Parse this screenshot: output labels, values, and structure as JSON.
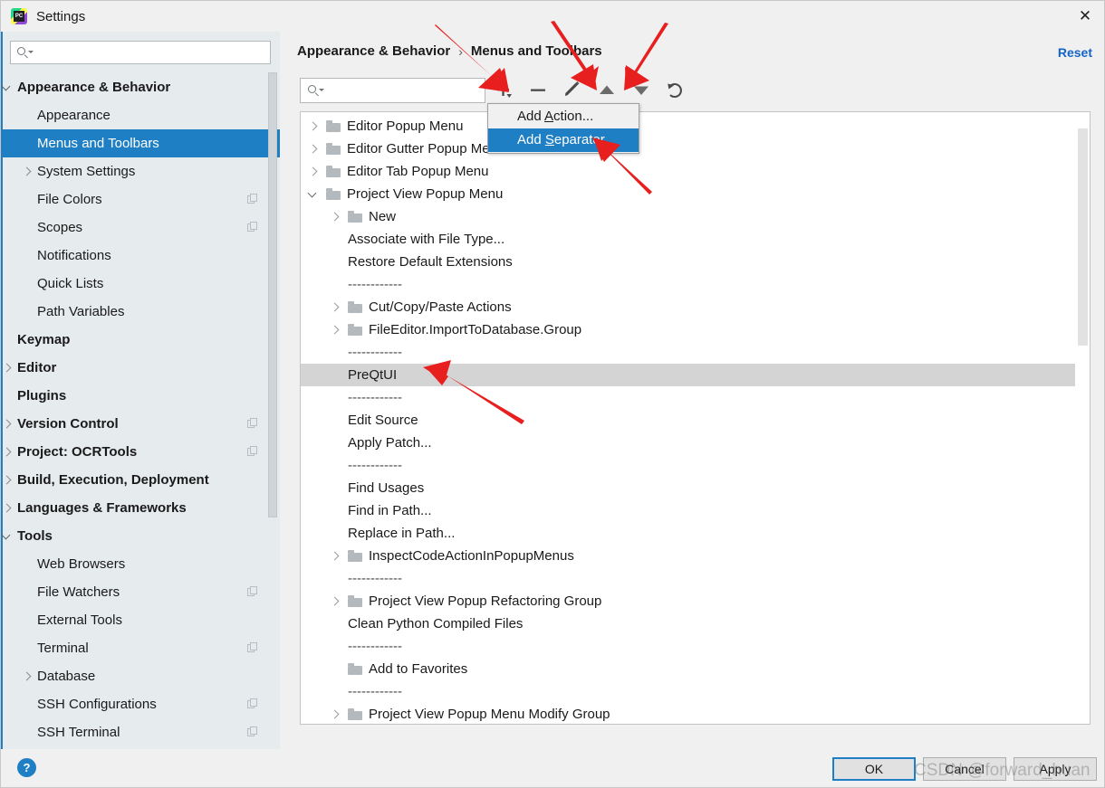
{
  "window": {
    "title": "Settings",
    "app_icon": "pycharm-icon",
    "close_icon": "close-icon"
  },
  "sidebar": {
    "search": {
      "placeholder": "",
      "value": "",
      "icon": "search-icon"
    },
    "items": [
      {
        "label": "Appearance & Behavior",
        "indent": 0,
        "arrow": "down",
        "bold": true,
        "selected": false,
        "copy": false
      },
      {
        "label": "Appearance",
        "indent": 1,
        "arrow": "none",
        "bold": false,
        "selected": false,
        "copy": false
      },
      {
        "label": "Menus and Toolbars",
        "indent": 1,
        "arrow": "none",
        "bold": false,
        "selected": true,
        "copy": false
      },
      {
        "label": "System Settings",
        "indent": 1,
        "arrow": "right",
        "bold": false,
        "selected": false,
        "copy": false
      },
      {
        "label": "File Colors",
        "indent": 1,
        "arrow": "none",
        "bold": false,
        "selected": false,
        "copy": true
      },
      {
        "label": "Scopes",
        "indent": 1,
        "arrow": "none",
        "bold": false,
        "selected": false,
        "copy": true
      },
      {
        "label": "Notifications",
        "indent": 1,
        "arrow": "none",
        "bold": false,
        "selected": false,
        "copy": false
      },
      {
        "label": "Quick Lists",
        "indent": 1,
        "arrow": "none",
        "bold": false,
        "selected": false,
        "copy": false
      },
      {
        "label": "Path Variables",
        "indent": 1,
        "arrow": "none",
        "bold": false,
        "selected": false,
        "copy": false
      },
      {
        "label": "Keymap",
        "indent": 0,
        "arrow": "none",
        "bold": true,
        "selected": false,
        "copy": false
      },
      {
        "label": "Editor",
        "indent": 0,
        "arrow": "right",
        "bold": true,
        "selected": false,
        "copy": false
      },
      {
        "label": "Plugins",
        "indent": 0,
        "arrow": "none",
        "bold": true,
        "selected": false,
        "copy": false
      },
      {
        "label": "Version Control",
        "indent": 0,
        "arrow": "right",
        "bold": true,
        "selected": false,
        "copy": true
      },
      {
        "label": "Project: OCRTools",
        "indent": 0,
        "arrow": "right",
        "bold": true,
        "selected": false,
        "copy": true
      },
      {
        "label": "Build, Execution, Deployment",
        "indent": 0,
        "arrow": "right",
        "bold": true,
        "selected": false,
        "copy": false
      },
      {
        "label": "Languages & Frameworks",
        "indent": 0,
        "arrow": "right",
        "bold": true,
        "selected": false,
        "copy": false
      },
      {
        "label": "Tools",
        "indent": 0,
        "arrow": "down",
        "bold": true,
        "selected": false,
        "copy": false
      },
      {
        "label": "Web Browsers",
        "indent": 1,
        "arrow": "none",
        "bold": false,
        "selected": false,
        "copy": false
      },
      {
        "label": "File Watchers",
        "indent": 1,
        "arrow": "none",
        "bold": false,
        "selected": false,
        "copy": true
      },
      {
        "label": "External Tools",
        "indent": 1,
        "arrow": "none",
        "bold": false,
        "selected": false,
        "copy": false
      },
      {
        "label": "Terminal",
        "indent": 1,
        "arrow": "none",
        "bold": false,
        "selected": false,
        "copy": true
      },
      {
        "label": "Database",
        "indent": 1,
        "arrow": "right",
        "bold": false,
        "selected": false,
        "copy": false
      },
      {
        "label": "SSH Configurations",
        "indent": 1,
        "arrow": "none",
        "bold": false,
        "selected": false,
        "copy": true
      },
      {
        "label": "SSH Terminal",
        "indent": 1,
        "arrow": "none",
        "bold": false,
        "selected": false,
        "copy": true
      }
    ]
  },
  "content": {
    "breadcrumb": {
      "parent": "Appearance & Behavior",
      "separator": "›",
      "current": "Menus and Toolbars"
    },
    "reset_label": "Reset",
    "search": {
      "placeholder": "",
      "value": "",
      "icon": "search-icon"
    },
    "toolbar": [
      {
        "name": "add-button",
        "icon": "plus-icon",
        "label": "Add"
      },
      {
        "name": "remove-button",
        "icon": "minus-icon",
        "label": "Remove"
      },
      {
        "name": "edit-button",
        "icon": "pencil-icon",
        "label": "Edit"
      },
      {
        "name": "move-up-button",
        "icon": "arrow-up-icon",
        "label": "Move Up"
      },
      {
        "name": "move-down-button",
        "icon": "arrow-down-icon",
        "label": "Move Down"
      },
      {
        "name": "restore-button",
        "icon": "revert-icon",
        "label": "Restore"
      }
    ],
    "tree": [
      {
        "label": "Editor Popup Menu",
        "indent": 0,
        "arrow": "right",
        "folder": true,
        "kind": "item",
        "selected": false
      },
      {
        "label": "Editor Gutter Popup Menu",
        "indent": 0,
        "arrow": "right",
        "folder": true,
        "kind": "item",
        "selected": false
      },
      {
        "label": "Editor Tab Popup Menu",
        "indent": 0,
        "arrow": "right",
        "folder": true,
        "kind": "item",
        "selected": false
      },
      {
        "label": "Project View Popup Menu",
        "indent": 0,
        "arrow": "down",
        "folder": true,
        "kind": "item",
        "selected": false
      },
      {
        "label": "New",
        "indent": 1,
        "arrow": "right",
        "folder": true,
        "kind": "item",
        "selected": false
      },
      {
        "label": "Associate with File Type...",
        "indent": 1,
        "arrow": "none",
        "folder": false,
        "kind": "item",
        "selected": false
      },
      {
        "label": "Restore Default Extensions",
        "indent": 1,
        "arrow": "none",
        "folder": false,
        "kind": "item",
        "selected": false
      },
      {
        "label": "------------",
        "indent": 1,
        "arrow": "none",
        "folder": false,
        "kind": "separator",
        "selected": false
      },
      {
        "label": "Cut/Copy/Paste Actions",
        "indent": 1,
        "arrow": "right",
        "folder": true,
        "kind": "item",
        "selected": false
      },
      {
        "label": "FileEditor.ImportToDatabase.Group",
        "indent": 1,
        "arrow": "right",
        "folder": true,
        "kind": "item",
        "selected": false
      },
      {
        "label": "------------",
        "indent": 1,
        "arrow": "none",
        "folder": false,
        "kind": "separator",
        "selected": false
      },
      {
        "label": "PreQtUI",
        "indent": 1,
        "arrow": "none",
        "folder": false,
        "kind": "item",
        "selected": true
      },
      {
        "label": "------------",
        "indent": 1,
        "arrow": "none",
        "folder": false,
        "kind": "separator",
        "selected": false
      },
      {
        "label": "Edit Source",
        "indent": 1,
        "arrow": "none",
        "folder": false,
        "kind": "item",
        "selected": false
      },
      {
        "label": "Apply Patch...",
        "indent": 1,
        "arrow": "none",
        "folder": false,
        "kind": "item",
        "selected": false
      },
      {
        "label": "------------",
        "indent": 1,
        "arrow": "none",
        "folder": false,
        "kind": "separator",
        "selected": false
      },
      {
        "label": "Find Usages",
        "indent": 1,
        "arrow": "none",
        "folder": false,
        "kind": "item",
        "selected": false
      },
      {
        "label": "Find in Path...",
        "indent": 1,
        "arrow": "none",
        "folder": false,
        "kind": "item",
        "selected": false
      },
      {
        "label": "Replace in Path...",
        "indent": 1,
        "arrow": "none",
        "folder": false,
        "kind": "item",
        "selected": false
      },
      {
        "label": "InspectCodeActionInPopupMenus",
        "indent": 1,
        "arrow": "right",
        "folder": true,
        "kind": "item",
        "selected": false
      },
      {
        "label": "------------",
        "indent": 1,
        "arrow": "none",
        "folder": false,
        "kind": "separator",
        "selected": false
      },
      {
        "label": "Project View Popup Refactoring Group",
        "indent": 1,
        "arrow": "right",
        "folder": true,
        "kind": "item",
        "selected": false
      },
      {
        "label": "Clean Python Compiled Files",
        "indent": 1,
        "arrow": "none",
        "folder": false,
        "kind": "item",
        "selected": false
      },
      {
        "label": "------------",
        "indent": 1,
        "arrow": "none",
        "folder": false,
        "kind": "separator",
        "selected": false
      },
      {
        "label": "Add to Favorites",
        "indent": 1,
        "arrow": "none",
        "folder": true,
        "kind": "item",
        "selected": false
      },
      {
        "label": "------------",
        "indent": 1,
        "arrow": "none",
        "folder": false,
        "kind": "separator",
        "selected": false
      },
      {
        "label": "Project View Popup Menu Modify Group",
        "indent": 1,
        "arrow": "right",
        "folder": true,
        "kind": "item",
        "selected": false
      }
    ]
  },
  "popup_menu": {
    "items": [
      {
        "prefix": "Add ",
        "mnemonic": "A",
        "suffix": "ction...",
        "highlighted": false
      },
      {
        "prefix": "Add ",
        "mnemonic": "S",
        "suffix": "eparator",
        "highlighted": true
      }
    ]
  },
  "footer": {
    "help_label": "?",
    "buttons": [
      {
        "name": "ok-button",
        "label": "OK",
        "default": true
      },
      {
        "name": "cancel-button",
        "label": "Cancel",
        "default": false
      },
      {
        "name": "apply-button",
        "label": "Apply",
        "default": false
      }
    ]
  },
  "watermark": "CSDN @forward_huan",
  "colors": {
    "accent_blue": "#1f7fc4",
    "link_blue": "#1464c8",
    "sidebar_bg": "#e6ebee",
    "panel_bg": "#f0f0f0",
    "selected_row_gray": "#d4d4d4",
    "annotation_red": "#e81f1f"
  }
}
